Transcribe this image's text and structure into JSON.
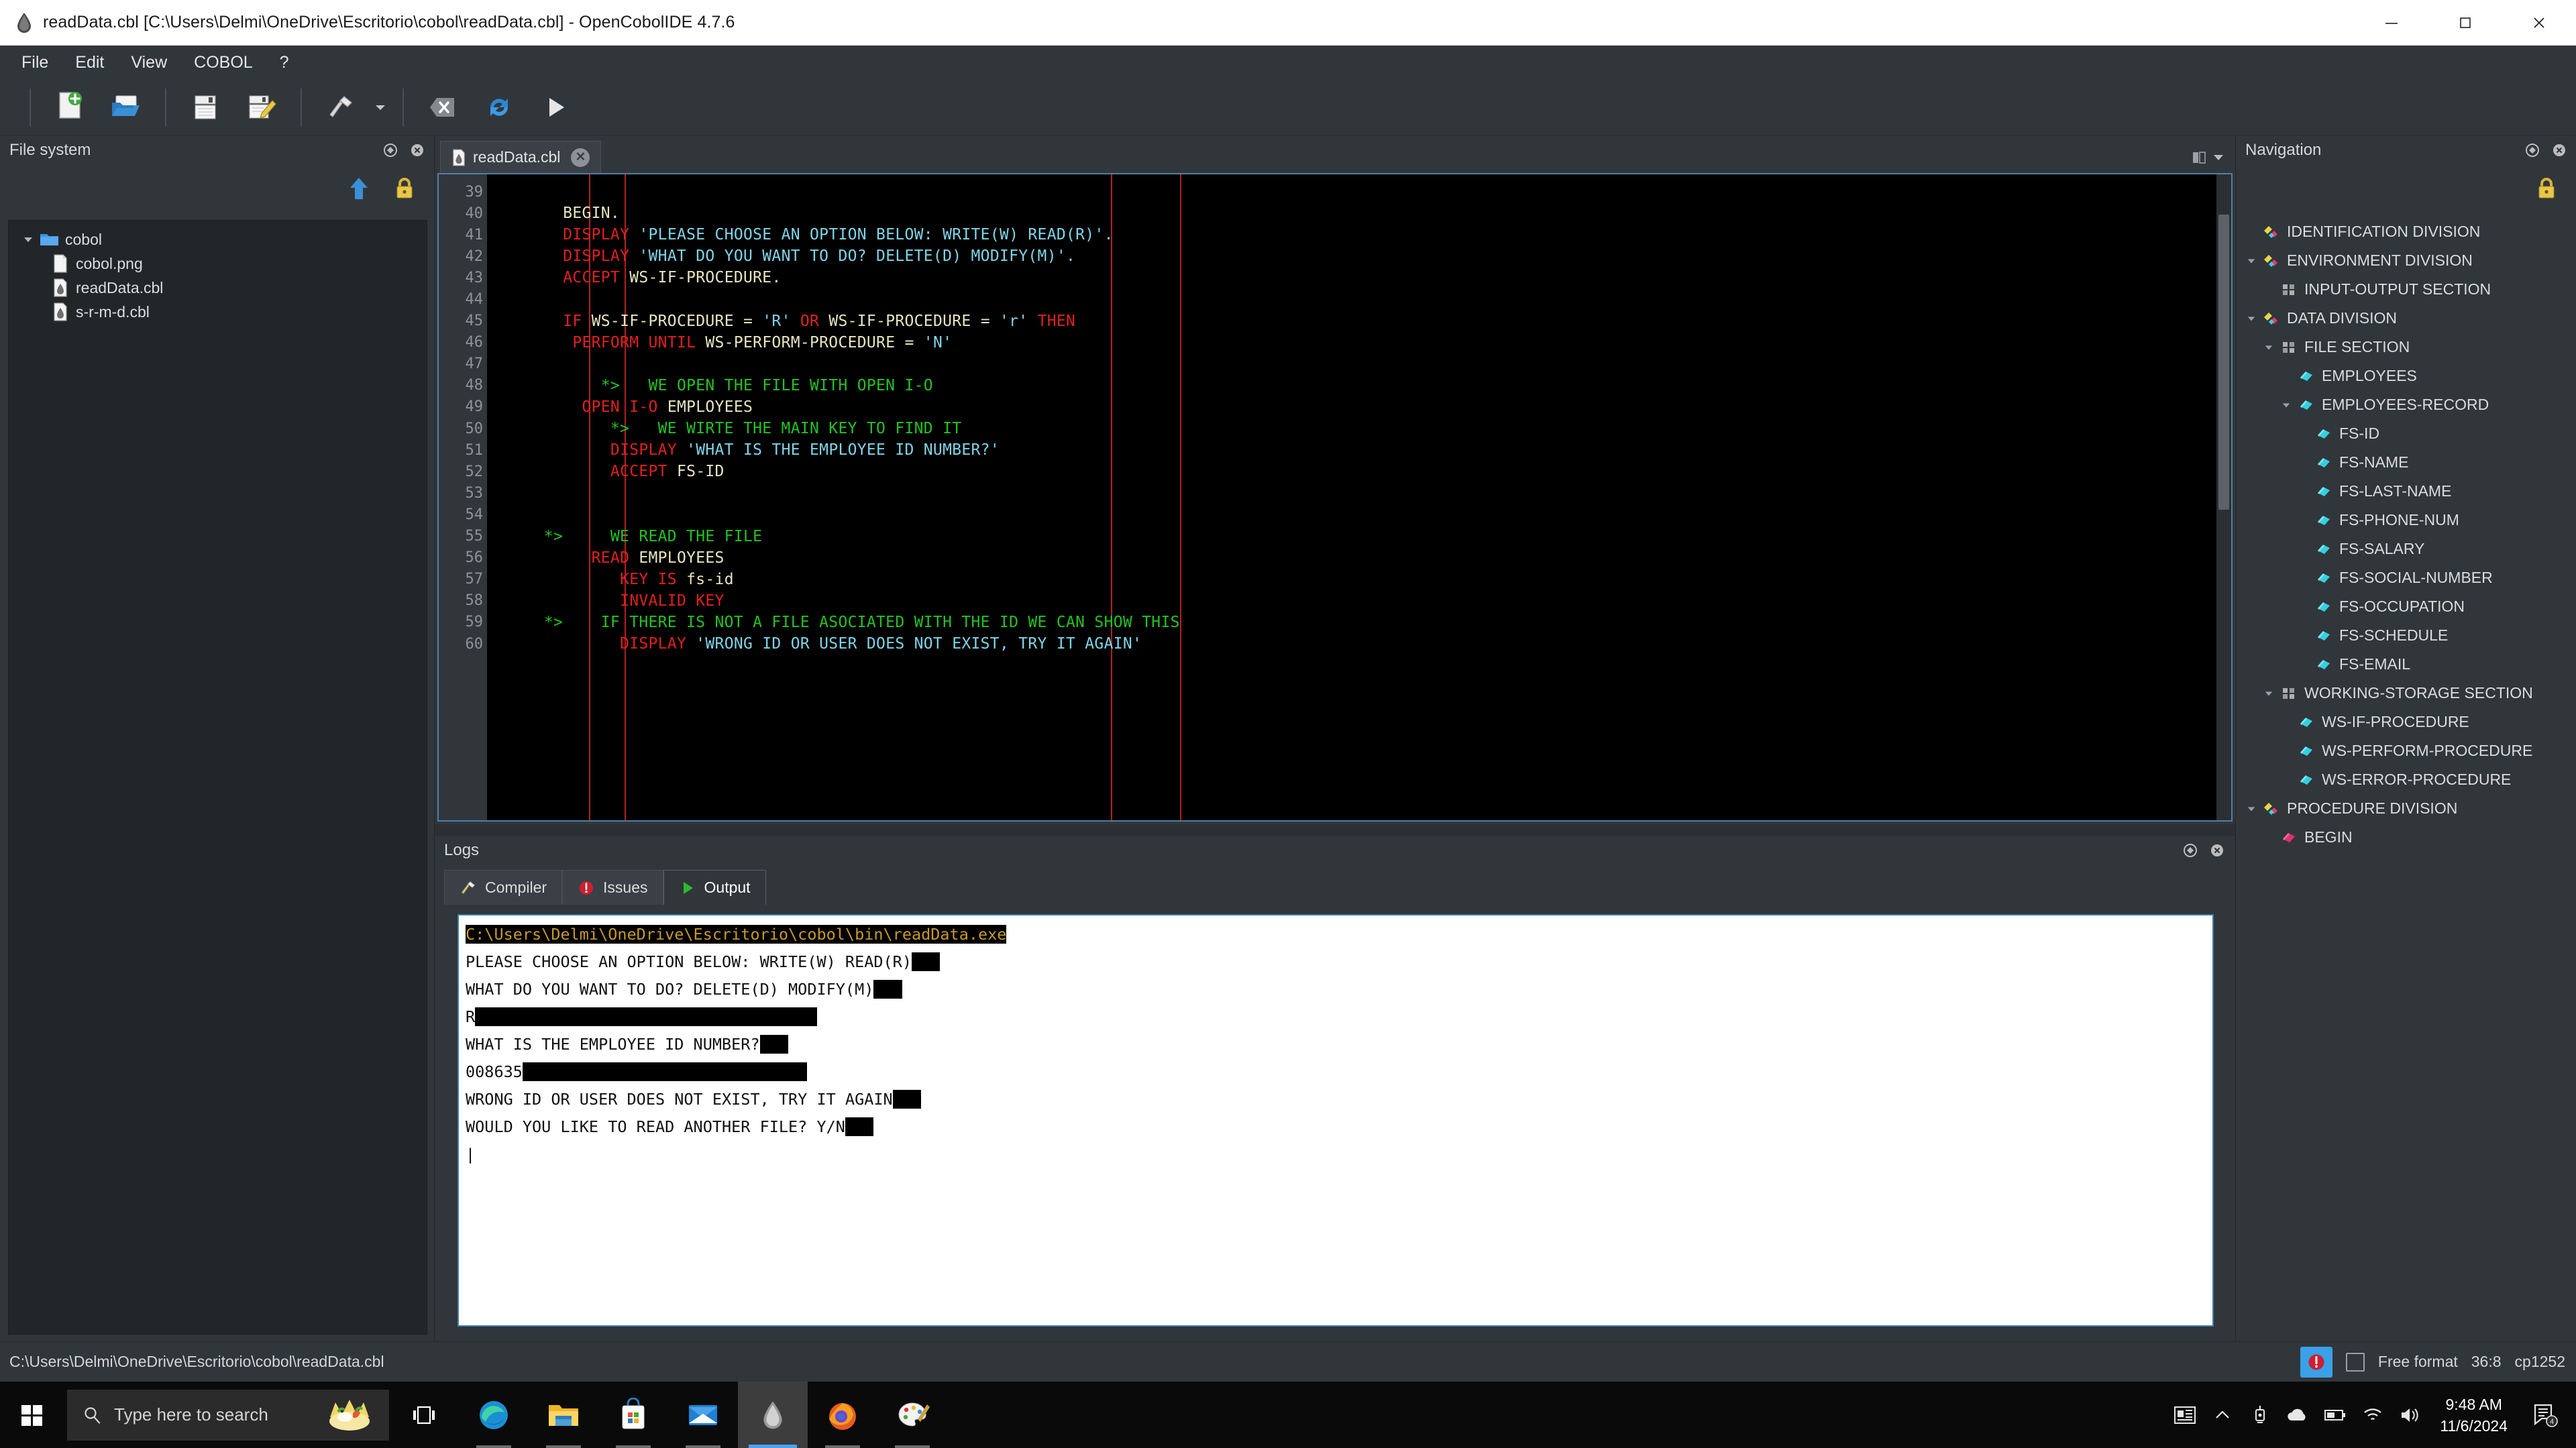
{
  "window": {
    "title": "readData.cbl [C:\\Users\\Delmi\\OneDrive\\Escritorio\\cobol\\readData.cbl] - OpenCobolIDE 4.7.6",
    "icon": "cobol-drop-icon",
    "minimize_label": "─",
    "maximize_label": "❐",
    "close_label": "✕"
  },
  "menubar": {
    "items": [
      {
        "label": "File"
      },
      {
        "label": "Edit"
      },
      {
        "label": "View"
      },
      {
        "label": "COBOL"
      },
      {
        "label": "?"
      }
    ]
  },
  "toolbar": {
    "buttons": [
      {
        "name": "new-file-button",
        "icon": "new-file-icon",
        "tooltip": "New file"
      },
      {
        "name": "open-file-button",
        "icon": "open-folder-icon",
        "tooltip": "Open file"
      },
      {
        "name": "save-button",
        "icon": "save-icon",
        "tooltip": "Save"
      },
      {
        "name": "save-as-button",
        "icon": "save-as-icon",
        "tooltip": "Save as"
      },
      {
        "name": "compile-button",
        "icon": "hammer-icon",
        "tooltip": "Compile"
      },
      {
        "name": "cancel-button",
        "icon": "cancel-icon",
        "tooltip": "Cancel"
      },
      {
        "name": "refresh-button",
        "icon": "refresh-icon",
        "tooltip": "Refresh"
      },
      {
        "name": "run-button",
        "icon": "play-icon",
        "tooltip": "Run"
      }
    ]
  },
  "filesystem": {
    "title": "File system",
    "tools": [
      {
        "name": "parent-dir-button",
        "icon": "up-arrow-icon"
      },
      {
        "name": "lock-button",
        "icon": "lock-icon"
      }
    ],
    "tree": [
      {
        "label": "cobol",
        "icon": "folder-icon",
        "depth": 0,
        "expanded": true
      },
      {
        "label": "cobol.png",
        "icon": "image-file-icon",
        "depth": 1,
        "expanded": null
      },
      {
        "label": "readData.cbl",
        "icon": "cobol-file-icon",
        "depth": 1,
        "expanded": null
      },
      {
        "label": "s-r-m-d.cbl",
        "icon": "cobol-file-icon",
        "depth": 1,
        "expanded": null
      }
    ]
  },
  "editor": {
    "tab": {
      "label": "readData.cbl",
      "icon": "cobol-file-icon",
      "close": "✕"
    },
    "first_line_number": 39,
    "lines": [
      {
        "n": 39,
        "fold": "",
        "tokens": []
      },
      {
        "n": 40,
        "fold": "",
        "tokens": [
          {
            "t": "        ",
            "c": "plain"
          },
          {
            "t": "BEGIN.",
            "c": "id"
          }
        ]
      },
      {
        "n": 41,
        "fold": "",
        "tokens": [
          {
            "t": "        ",
            "c": "plain"
          },
          {
            "t": "DISPLAY",
            "c": "kw"
          },
          {
            "t": " ",
            "c": "plain"
          },
          {
            "t": "'PLEASE CHOOSE AN OPTION BELOW: WRITE(W) READ(R)'.",
            "c": "str"
          }
        ]
      },
      {
        "n": 42,
        "fold": "",
        "tokens": [
          {
            "t": "        ",
            "c": "plain"
          },
          {
            "t": "DISPLAY",
            "c": "kw"
          },
          {
            "t": " ",
            "c": "plain"
          },
          {
            "t": "'WHAT DO YOU WANT TO DO? DELETE(D) MODIFY(M)'.",
            "c": "str"
          }
        ]
      },
      {
        "n": 43,
        "fold": "",
        "tokens": [
          {
            "t": "        ",
            "c": "plain"
          },
          {
            "t": "ACCEPT",
            "c": "kw"
          },
          {
            "t": " ",
            "c": "plain"
          },
          {
            "t": "WS-IF-PROCEDURE.",
            "c": "id"
          }
        ]
      },
      {
        "n": 44,
        "fold": "",
        "tokens": []
      },
      {
        "n": 45,
        "fold": "",
        "tokens": [
          {
            "t": "        ",
            "c": "plain"
          },
          {
            "t": "IF",
            "c": "kw"
          },
          {
            "t": " WS-IF-PROCEDURE = ",
            "c": "id"
          },
          {
            "t": "'R'",
            "c": "str"
          },
          {
            "t": " ",
            "c": "plain"
          },
          {
            "t": "OR",
            "c": "kw"
          },
          {
            "t": " WS-IF-PROCEDURE = ",
            "c": "id"
          },
          {
            "t": "'r'",
            "c": "str"
          },
          {
            "t": " ",
            "c": "plain"
          },
          {
            "t": "THEN",
            "c": "kw"
          }
        ]
      },
      {
        "n": 46,
        "fold": "",
        "tokens": [
          {
            "t": "         ",
            "c": "plain"
          },
          {
            "t": "PERFORM UNTIL",
            "c": "kw"
          },
          {
            "t": " WS-PERFORM-PROCEDURE = ",
            "c": "id"
          },
          {
            "t": "'N'",
            "c": "str"
          }
        ]
      },
      {
        "n": 47,
        "fold": "",
        "tokens": []
      },
      {
        "n": 48,
        "fold": "",
        "tokens": [
          {
            "t": "            *>   WE OPEN THE FILE WITH OPEN I-O",
            "c": "cmt"
          }
        ]
      },
      {
        "n": 49,
        "fold": "",
        "tokens": [
          {
            "t": "          ",
            "c": "plain"
          },
          {
            "t": "OPEN I-O",
            "c": "kw"
          },
          {
            "t": " EMPLOYEES",
            "c": "id"
          }
        ]
      },
      {
        "n": 50,
        "fold": "▼",
        "tokens": [
          {
            "t": "             *>   WE WIRTE THE MAIN KEY TO FIND IT",
            "c": "cmt"
          }
        ]
      },
      {
        "n": 51,
        "fold": "",
        "tokens": [
          {
            "t": "             ",
            "c": "plain"
          },
          {
            "t": "DISPLAY",
            "c": "kw"
          },
          {
            "t": " ",
            "c": "plain"
          },
          {
            "t": "'WHAT IS THE EMPLOYEE ID NUMBER?'",
            "c": "str"
          }
        ]
      },
      {
        "n": 52,
        "fold": "",
        "tokens": [
          {
            "t": "             ",
            "c": "plain"
          },
          {
            "t": "ACCEPT",
            "c": "kw"
          },
          {
            "t": " FS-ID",
            "c": "id"
          }
        ]
      },
      {
        "n": 53,
        "fold": "",
        "tokens": []
      },
      {
        "n": 54,
        "fold": "",
        "tokens": []
      },
      {
        "n": 55,
        "fold": "",
        "tokens": [
          {
            "t": "      *>     WE READ THE FILE",
            "c": "cmt"
          }
        ]
      },
      {
        "n": 56,
        "fold": "▼",
        "tokens": [
          {
            "t": "           ",
            "c": "plain"
          },
          {
            "t": "READ",
            "c": "kw"
          },
          {
            "t": " EMPLOYEES",
            "c": "id"
          }
        ]
      },
      {
        "n": 57,
        "fold": "",
        "tokens": [
          {
            "t": "              ",
            "c": "plain"
          },
          {
            "t": "KEY IS",
            "c": "kw"
          },
          {
            "t": " fs-id",
            "c": "id"
          }
        ]
      },
      {
        "n": 58,
        "fold": "",
        "tokens": [
          {
            "t": "              ",
            "c": "plain"
          },
          {
            "t": "INVALID KEY",
            "c": "kw"
          }
        ]
      },
      {
        "n": 59,
        "fold": "",
        "tokens": [
          {
            "t": "      *>    IF THERE IS NOT A FILE ASOCIATED WITH THE ID WE CAN SHOW THIS",
            "c": "cmt"
          }
        ]
      },
      {
        "n": 60,
        "fold": "",
        "tokens": [
          {
            "t": "              ",
            "c": "plain"
          },
          {
            "t": "DISPLAY",
            "c": "kw"
          },
          {
            "t": " ",
            "c": "plain"
          },
          {
            "t": "'WRONG ID OR USER DOES NOT EXIST, TRY IT AGAIN'",
            "c": "str"
          }
        ]
      }
    ]
  },
  "logs": {
    "title": "Logs",
    "tabs": [
      {
        "label": "Compiler",
        "icon": "hammer-icon",
        "active": false
      },
      {
        "label": "Issues",
        "icon": "error-circle-icon",
        "active": false
      },
      {
        "label": "Output",
        "icon": "play-icon",
        "active": true
      }
    ],
    "panel_buttons": [
      {
        "name": "logs-settings-button",
        "icon": "gear-icon"
      },
      {
        "name": "logs-close-button",
        "icon": "close-icon"
      }
    ],
    "console": [
      {
        "segments": [
          {
            "text": "C:\\Users\\Delmi\\OneDrive\\Escritorio\\cobol\\bin\\readData.exe",
            "style": "path"
          }
        ]
      },
      {
        "segments": [
          {
            "text": "PLEASE CHOOSE AN OPTION BELOW: WRITE(W) READ(R)",
            "style": "normal"
          },
          {
            "text": "   ",
            "style": "sel"
          }
        ]
      },
      {
        "segments": [
          {
            "text": "WHAT DO YOU WANT TO DO? DELETE(D) MODIFY(M)",
            "style": "normal"
          },
          {
            "text": "   ",
            "style": "sel"
          }
        ]
      },
      {
        "segments": [
          {
            "text": "R",
            "style": "normal"
          },
          {
            "text": "                                    ",
            "style": "sel"
          }
        ]
      },
      {
        "segments": [
          {
            "text": "WHAT IS THE EMPLOYEE ID NUMBER?",
            "style": "normal"
          },
          {
            "text": "   ",
            "style": "sel"
          }
        ]
      },
      {
        "segments": [
          {
            "text": "008635",
            "style": "normal"
          },
          {
            "text": "                              ",
            "style": "sel"
          }
        ]
      },
      {
        "segments": [
          {
            "text": "WRONG ID OR USER DOES NOT EXIST, TRY IT AGAIN",
            "style": "normal"
          },
          {
            "text": "   ",
            "style": "sel"
          }
        ]
      },
      {
        "segments": [
          {
            "text": "WOULD YOU LIKE TO READ ANOTHER FILE? Y/N",
            "style": "normal"
          },
          {
            "text": "   ",
            "style": "sel"
          }
        ]
      },
      {
        "segments": [
          {
            "text": "|",
            "style": "normal"
          }
        ]
      }
    ]
  },
  "navigation": {
    "title": "Navigation",
    "tools": [
      {
        "name": "nav-lock-button",
        "icon": "lock-icon"
      }
    ],
    "tree": [
      {
        "label": "IDENTIFICATION DIVISION",
        "depth": 0,
        "icon": "division-icon",
        "expanded": null
      },
      {
        "label": "ENVIRONMENT DIVISION",
        "depth": 0,
        "icon": "division-icon",
        "expanded": true
      },
      {
        "label": "INPUT-OUTPUT SECTION",
        "depth": 1,
        "icon": "section-icon",
        "expanded": null
      },
      {
        "label": "DATA DIVISION",
        "depth": 0,
        "icon": "division-icon",
        "expanded": true
      },
      {
        "label": "FILE SECTION",
        "depth": 1,
        "icon": "section-icon",
        "expanded": true
      },
      {
        "label": "EMPLOYEES",
        "depth": 2,
        "icon": "variable-icon",
        "expanded": null
      },
      {
        "label": "EMPLOYEES-RECORD",
        "depth": 2,
        "icon": "variable-icon",
        "expanded": true
      },
      {
        "label": "FS-ID",
        "depth": 3,
        "icon": "variable-icon",
        "expanded": null
      },
      {
        "label": "FS-NAME",
        "depth": 3,
        "icon": "variable-icon",
        "expanded": null
      },
      {
        "label": "FS-LAST-NAME",
        "depth": 3,
        "icon": "variable-icon",
        "expanded": null
      },
      {
        "label": "FS-PHONE-NUM",
        "depth": 3,
        "icon": "variable-icon",
        "expanded": null
      },
      {
        "label": "FS-SALARY",
        "depth": 3,
        "icon": "variable-icon",
        "expanded": null
      },
      {
        "label": "FS-SOCIAL-NUMBER",
        "depth": 3,
        "icon": "variable-icon",
        "expanded": null
      },
      {
        "label": "FS-OCCUPATION",
        "depth": 3,
        "icon": "variable-icon",
        "expanded": null
      },
      {
        "label": "FS-SCHEDULE",
        "depth": 3,
        "icon": "variable-icon",
        "expanded": null
      },
      {
        "label": "FS-EMAIL",
        "depth": 3,
        "icon": "variable-icon",
        "expanded": null
      },
      {
        "label": "WORKING-STORAGE SECTION",
        "depth": 1,
        "icon": "section-icon",
        "expanded": true
      },
      {
        "label": "WS-IF-PROCEDURE",
        "depth": 2,
        "icon": "variable-icon",
        "expanded": null
      },
      {
        "label": "WS-PERFORM-PROCEDURE",
        "depth": 2,
        "icon": "variable-icon",
        "expanded": null
      },
      {
        "label": "WS-ERROR-PROCEDURE",
        "depth": 2,
        "icon": "variable-icon",
        "expanded": null
      },
      {
        "label": "PROCEDURE DIVISION",
        "depth": 0,
        "icon": "division-icon",
        "expanded": true
      },
      {
        "label": "BEGIN",
        "depth": 1,
        "icon": "paragraph-icon",
        "expanded": null
      }
    ]
  },
  "statusbar": {
    "path": "C:\\Users\\Delmi\\OneDrive\\Escritorio\\cobol\\readData.cbl",
    "error_button_icon": "error-circle-icon",
    "free_format_label": "Free format",
    "free_format_checked": false,
    "cursor_position": "36:8",
    "encoding": "cp1252"
  },
  "taskbar": {
    "start_icon": "windows-logo-icon",
    "search_placeholder": "Type here to search",
    "search_icon": "search-icon",
    "search_image_icon": "nachos-illustration-icon",
    "task_view_icon": "task-view-icon",
    "apps": [
      {
        "name": "taskbar-edge",
        "icon": "edge-icon",
        "state": "open"
      },
      {
        "name": "taskbar-file-explorer",
        "icon": "file-explorer-icon",
        "state": "open"
      },
      {
        "name": "taskbar-microsoft-store",
        "icon": "microsoft-store-icon",
        "state": "open"
      },
      {
        "name": "taskbar-mail",
        "icon": "mail-icon",
        "state": "open"
      },
      {
        "name": "taskbar-opencobolide",
        "icon": "cobol-drop-icon",
        "state": "active"
      },
      {
        "name": "taskbar-firefox",
        "icon": "firefox-icon",
        "state": "open"
      },
      {
        "name": "taskbar-paint",
        "icon": "paint-icon",
        "state": "open"
      }
    ],
    "tray": [
      {
        "name": "tray-news-and-interests",
        "icon": "news-icon"
      },
      {
        "name": "tray-show-hidden",
        "icon": "chevron-up-icon"
      },
      {
        "name": "tray-safely-remove",
        "icon": "usb-eject-icon"
      },
      {
        "name": "tray-onedrive",
        "icon": "cloud-icon"
      },
      {
        "name": "tray-battery",
        "icon": "battery-icon"
      },
      {
        "name": "tray-network",
        "icon": "wifi-icon"
      },
      {
        "name": "tray-volume",
        "icon": "speaker-icon"
      }
    ],
    "clock_time": "9:48 AM",
    "clock_date": "11/6/2024",
    "notifications_icon": "notification-icon",
    "notifications_count": "4"
  },
  "colors": {
    "chrome": "#31363b",
    "editor_bg": "#000000",
    "accent_blue": "#3aa0e8",
    "keyword_red": "#e02020",
    "string_cyan": "#7fd4e8",
    "comment_green": "#23c223",
    "identifier": "#e8e4c0",
    "margin_red": "#b42020"
  }
}
